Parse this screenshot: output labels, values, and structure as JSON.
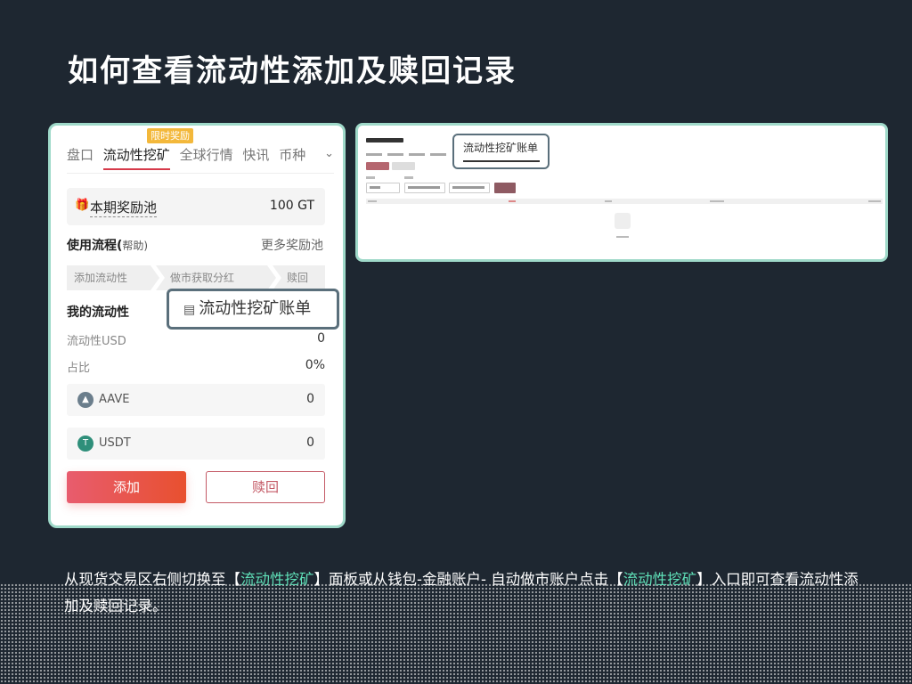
{
  "slide": {
    "title": "如何查看流动性添加及赎回记录",
    "caption": {
      "part1": "从现货交易区右侧切换至【",
      "hl1": "流动性挖矿",
      "part2": "】面板或从钱包-金融账户- 自动做市账户点击【",
      "hl2": "流动性挖矿",
      "part3": "】入口即可查看流动性添加及赎回记录。"
    }
  },
  "left_panel": {
    "badge": "限时奖励",
    "tabs": [
      "盘口",
      "流动性挖矿",
      "全球行情",
      "快讯",
      "币种"
    ],
    "active_tab": "流动性挖矿",
    "pool": {
      "label": "本期奖励池",
      "value": "100 GT"
    },
    "flow": {
      "title": "使用流程(",
      "help": "帮助)",
      "more": "更多奖励池"
    },
    "steps": [
      "添加流动性",
      "做市获取分红",
      "赎回"
    ],
    "my_liquidity": {
      "title": "我的流动性",
      "usd_label": "流动性USD",
      "usd_value": "0",
      "ratio_label": "占比",
      "ratio_value": "0%"
    },
    "assets": [
      {
        "name": "AAVE",
        "amount": "0",
        "color": "#6b7e8c"
      },
      {
        "name": "USDT",
        "amount": "0",
        "color": "#2f8f7a"
      }
    ],
    "buttons": {
      "add": "添加",
      "redeem": "赎回"
    },
    "callout": "流动性挖矿账单"
  },
  "right_panel": {
    "callout": "流动性挖矿账单"
  }
}
